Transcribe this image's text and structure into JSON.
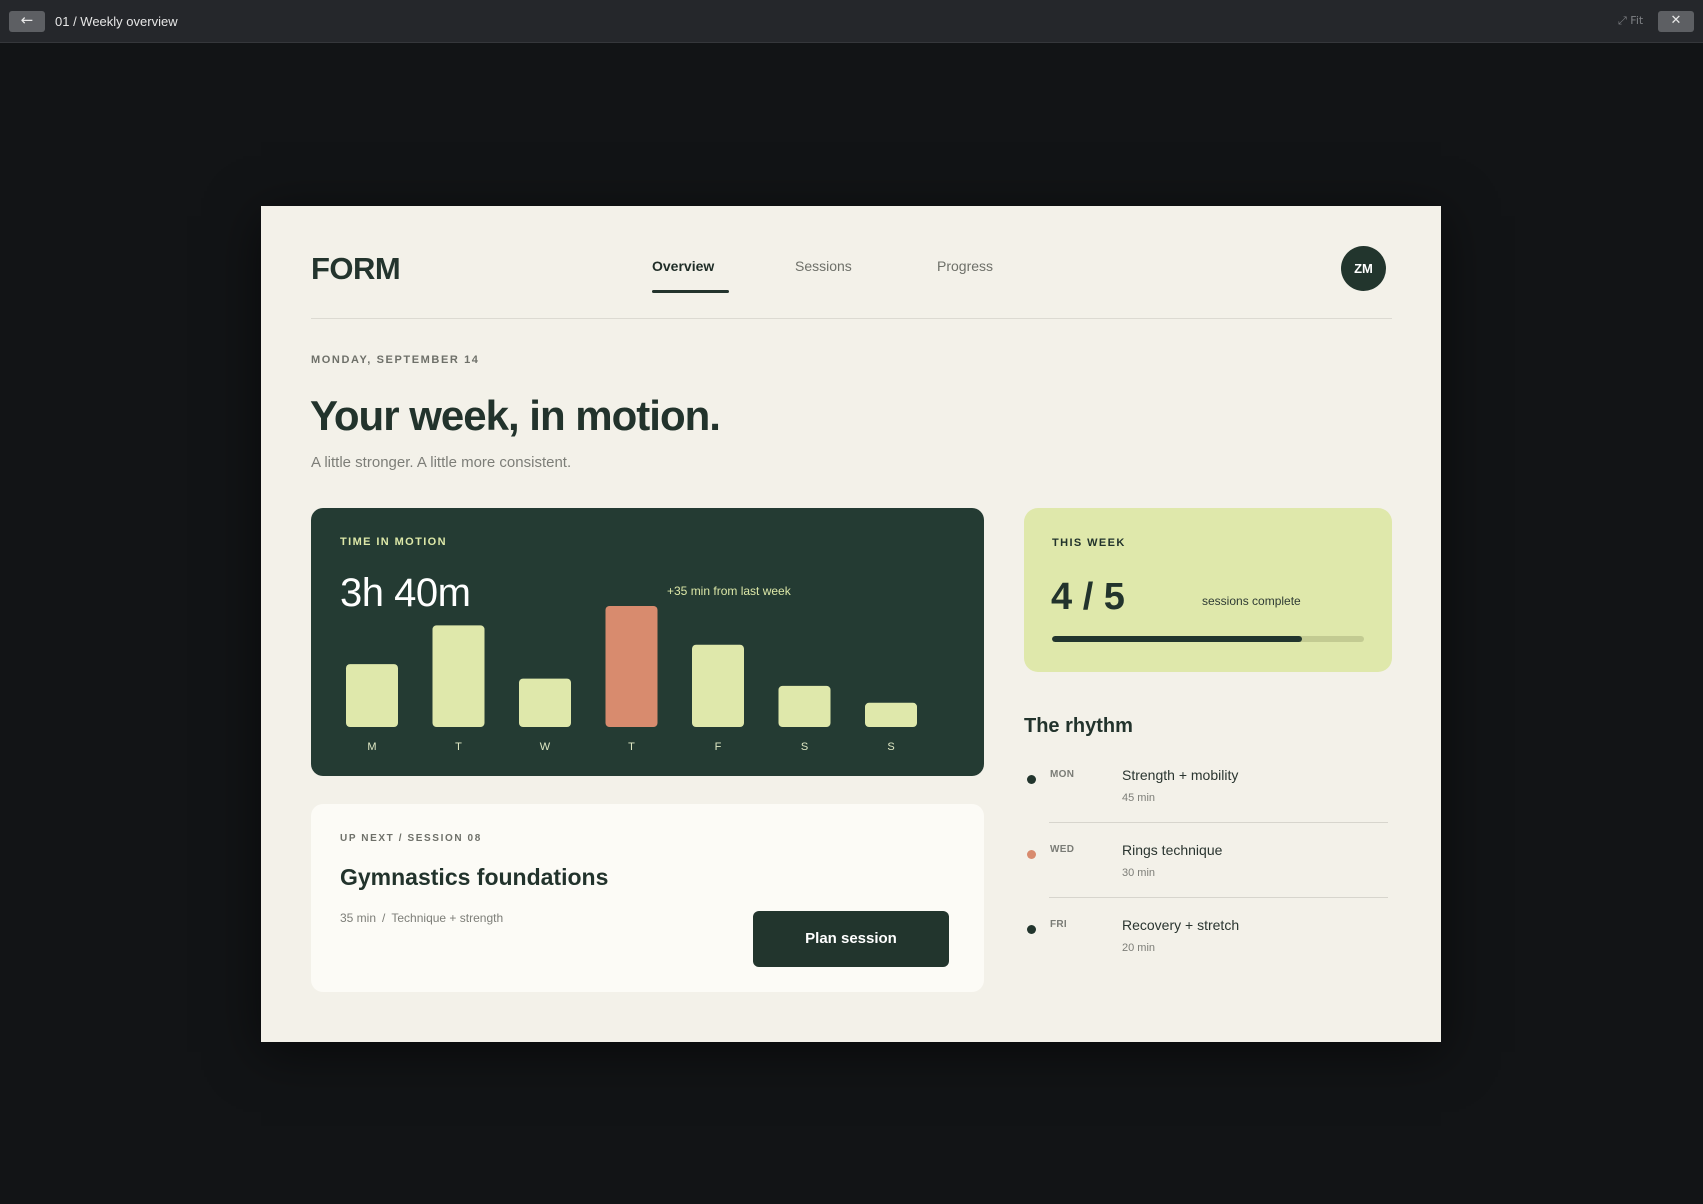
{
  "viewer": {
    "back_icon": "←",
    "title": "01 / Weekly overview",
    "fit_label": "⤢ Fit",
    "close_icon": "✕"
  },
  "app": {
    "logo": "FORM",
    "nav": [
      {
        "label": "Overview",
        "active": true
      },
      {
        "label": "Sessions",
        "active": false
      },
      {
        "label": "Progress",
        "active": false
      }
    ],
    "avatar_initials": "ZM"
  },
  "header": {
    "date": "MONDAY, SEPTEMBER 14",
    "title": "Your week, in motion.",
    "subtitle": "A little stronger. A little more consistent."
  },
  "time_card": {
    "label": "TIME IN MOTION",
    "total": "3h 40m",
    "delta": "+35 min from last week"
  },
  "chart_data": {
    "type": "bar",
    "categories": [
      "M",
      "T",
      "W",
      "T",
      "F",
      "S",
      "S"
    ],
    "values": [
      26,
      42,
      20,
      50,
      34,
      17,
      10
    ],
    "highlight_index": 3,
    "bar_color": "#dfe8ab",
    "highlight_color": "#d88b6e",
    "title": "",
    "xlabel": "",
    "ylabel": ""
  },
  "up_next": {
    "label": "UP NEXT / SESSION 08",
    "title": "Gymnastics foundations",
    "duration": "35 min",
    "separator": "/",
    "focus": "Technique + strength",
    "button": "Plan session"
  },
  "this_week": {
    "label": "THIS WEEK",
    "value": "4 / 5",
    "caption": "sessions complete",
    "progress": 0.8
  },
  "rhythm": {
    "title": "The rhythm",
    "items": [
      {
        "day": "MON",
        "name": "Strength + mobility",
        "duration": "45 min",
        "dot_color": "#22352d"
      },
      {
        "day": "WED",
        "name": "Rings technique",
        "duration": "30 min",
        "dot_color": "#d88b6e"
      },
      {
        "day": "FRI",
        "name": "Recovery + stretch",
        "duration": "20 min",
        "dot_color": "#22352d"
      }
    ]
  },
  "colors": {
    "accent": "#22352d",
    "lime": "#dfe8ab",
    "coral": "#d88b6e",
    "background": "#f3f1e9"
  }
}
